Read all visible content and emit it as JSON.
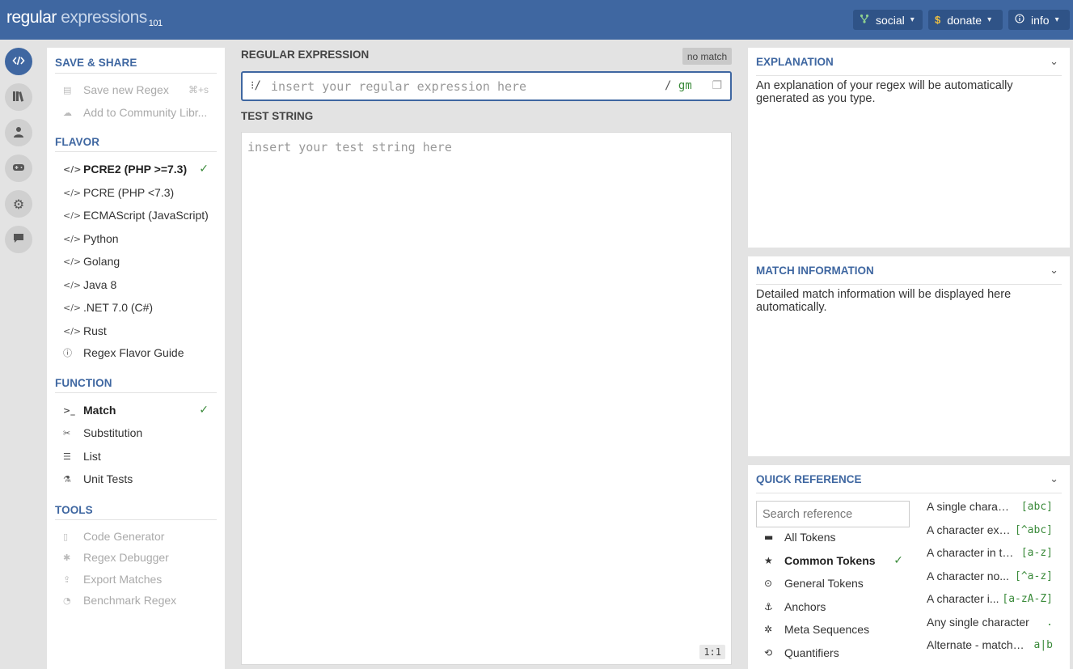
{
  "header": {
    "logo_main": "regular",
    "logo_sub": " expressions",
    "logo_version": "101",
    "buttons": [
      {
        "label": "social",
        "icon": "branch-icon"
      },
      {
        "label": "donate",
        "icon": "dollar-icon"
      },
      {
        "label": "info",
        "icon": "info-icon"
      }
    ]
  },
  "rail": {
    "items": [
      "code-icon",
      "library-icon",
      "user-icon",
      "gamepad-icon",
      "gear-icon",
      "chat-icon"
    ]
  },
  "sidebar": {
    "save_share": {
      "title": "SAVE & SHARE",
      "items": [
        {
          "label": "Save new Regex",
          "shortcut": "⌘+s"
        },
        {
          "label": "Add to Community Libr..."
        }
      ]
    },
    "flavor": {
      "title": "FLAVOR",
      "items": [
        {
          "label": "PCRE2 (PHP >=7.3)",
          "selected": true
        },
        {
          "label": "PCRE (PHP <7.3)"
        },
        {
          "label": "ECMAScript (JavaScript)"
        },
        {
          "label": "Python"
        },
        {
          "label": "Golang"
        },
        {
          "label": "Java 8"
        },
        {
          "label": ".NET 7.0 (C#)"
        },
        {
          "label": "Rust"
        },
        {
          "label": "Regex Flavor Guide"
        }
      ]
    },
    "function": {
      "title": "FUNCTION",
      "items": [
        {
          "label": "Match",
          "selected": true
        },
        {
          "label": "Substitution"
        },
        {
          "label": "List"
        },
        {
          "label": "Unit Tests"
        }
      ]
    },
    "tools": {
      "title": "TOOLS",
      "items": [
        {
          "label": "Code Generator"
        },
        {
          "label": "Regex Debugger"
        },
        {
          "label": "Export Matches"
        },
        {
          "label": "Benchmark Regex"
        }
      ]
    }
  },
  "editor": {
    "regex_title": "REGULAR EXPRESSION",
    "status": "no match",
    "regex_lead": "⁝/",
    "regex_placeholder": "insert your regular expression here",
    "regex_delim": "/",
    "regex_flags": "gm",
    "test_title": "TEST STRING",
    "test_placeholder": "insert your test string here",
    "cursor_pos": "1:1"
  },
  "explanation": {
    "title": "EXPLANATION",
    "text": "An explanation of your regex will be automatically generated as you type."
  },
  "match_info": {
    "title": "MATCH INFORMATION",
    "text": "Detailed match information will be displayed here automatically."
  },
  "quick_ref": {
    "title": "QUICK REFERENCE",
    "search_placeholder": "Search reference",
    "categories": [
      {
        "label": "All Tokens",
        "icon": "stack-icon"
      },
      {
        "label": "Common Tokens",
        "icon": "star-icon",
        "selected": true
      },
      {
        "label": "General Tokens",
        "icon": "circle-dot-icon"
      },
      {
        "label": "Anchors",
        "icon": "anchor-icon"
      },
      {
        "label": "Meta Sequences",
        "icon": "asterisk-icon"
      },
      {
        "label": "Quantifiers",
        "icon": "quantifier-icon"
      }
    ],
    "tokens": [
      {
        "desc": "A single charact...",
        "token": "[abc]"
      },
      {
        "desc": "A character exc...",
        "token": "[^abc]"
      },
      {
        "desc": "A character in th...",
        "token": "[a-z]"
      },
      {
        "desc": "A character no...",
        "token": "[^a-z]"
      },
      {
        "desc": "A character i...",
        "token": "[a-zA-Z]"
      },
      {
        "desc": "Any single character",
        "token": "."
      },
      {
        "desc": "Alternate - match e...",
        "token": "a|b"
      }
    ]
  }
}
